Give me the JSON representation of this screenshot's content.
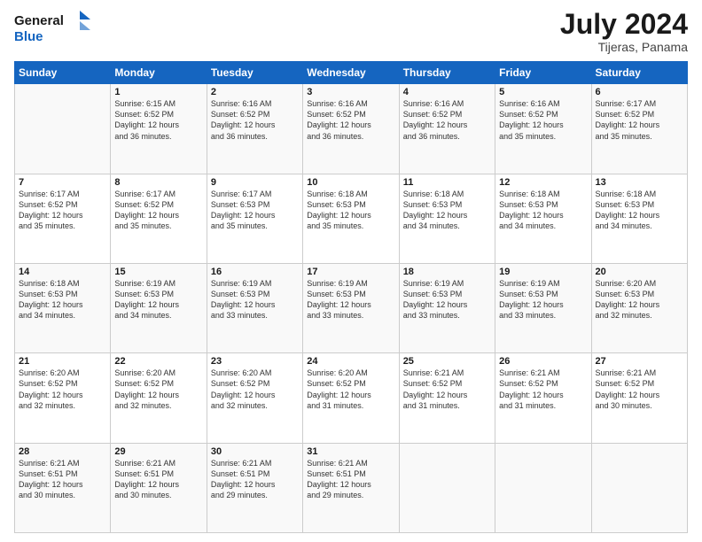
{
  "header": {
    "logo_line1": "General",
    "logo_line2": "Blue",
    "month_title": "July 2024",
    "location": "Tijeras, Panama"
  },
  "weekdays": [
    "Sunday",
    "Monday",
    "Tuesday",
    "Wednesday",
    "Thursday",
    "Friday",
    "Saturday"
  ],
  "weeks": [
    [
      {
        "day": null
      },
      {
        "day": "1",
        "sunrise": "6:15 AM",
        "sunset": "6:52 PM",
        "daylight": "12 hours and 36 minutes."
      },
      {
        "day": "2",
        "sunrise": "6:16 AM",
        "sunset": "6:52 PM",
        "daylight": "12 hours and 36 minutes."
      },
      {
        "day": "3",
        "sunrise": "6:16 AM",
        "sunset": "6:52 PM",
        "daylight": "12 hours and 36 minutes."
      },
      {
        "day": "4",
        "sunrise": "6:16 AM",
        "sunset": "6:52 PM",
        "daylight": "12 hours and 36 minutes."
      },
      {
        "day": "5",
        "sunrise": "6:16 AM",
        "sunset": "6:52 PM",
        "daylight": "12 hours and 35 minutes."
      },
      {
        "day": "6",
        "sunrise": "6:17 AM",
        "sunset": "6:52 PM",
        "daylight": "12 hours and 35 minutes."
      }
    ],
    [
      {
        "day": "7",
        "sunrise": "6:17 AM",
        "sunset": "6:52 PM",
        "daylight": "12 hours and 35 minutes."
      },
      {
        "day": "8",
        "sunrise": "6:17 AM",
        "sunset": "6:52 PM",
        "daylight": "12 hours and 35 minutes."
      },
      {
        "day": "9",
        "sunrise": "6:17 AM",
        "sunset": "6:53 PM",
        "daylight": "12 hours and 35 minutes."
      },
      {
        "day": "10",
        "sunrise": "6:18 AM",
        "sunset": "6:53 PM",
        "daylight": "12 hours and 35 minutes."
      },
      {
        "day": "11",
        "sunrise": "6:18 AM",
        "sunset": "6:53 PM",
        "daylight": "12 hours and 34 minutes."
      },
      {
        "day": "12",
        "sunrise": "6:18 AM",
        "sunset": "6:53 PM",
        "daylight": "12 hours and 34 minutes."
      },
      {
        "day": "13",
        "sunrise": "6:18 AM",
        "sunset": "6:53 PM",
        "daylight": "12 hours and 34 minutes."
      }
    ],
    [
      {
        "day": "14",
        "sunrise": "6:18 AM",
        "sunset": "6:53 PM",
        "daylight": "12 hours and 34 minutes."
      },
      {
        "day": "15",
        "sunrise": "6:19 AM",
        "sunset": "6:53 PM",
        "daylight": "12 hours and 34 minutes."
      },
      {
        "day": "16",
        "sunrise": "6:19 AM",
        "sunset": "6:53 PM",
        "daylight": "12 hours and 33 minutes."
      },
      {
        "day": "17",
        "sunrise": "6:19 AM",
        "sunset": "6:53 PM",
        "daylight": "12 hours and 33 minutes."
      },
      {
        "day": "18",
        "sunrise": "6:19 AM",
        "sunset": "6:53 PM",
        "daylight": "12 hours and 33 minutes."
      },
      {
        "day": "19",
        "sunrise": "6:19 AM",
        "sunset": "6:53 PM",
        "daylight": "12 hours and 33 minutes."
      },
      {
        "day": "20",
        "sunrise": "6:20 AM",
        "sunset": "6:53 PM",
        "daylight": "12 hours and 32 minutes."
      }
    ],
    [
      {
        "day": "21",
        "sunrise": "6:20 AM",
        "sunset": "6:52 PM",
        "daylight": "12 hours and 32 minutes."
      },
      {
        "day": "22",
        "sunrise": "6:20 AM",
        "sunset": "6:52 PM",
        "daylight": "12 hours and 32 minutes."
      },
      {
        "day": "23",
        "sunrise": "6:20 AM",
        "sunset": "6:52 PM",
        "daylight": "12 hours and 32 minutes."
      },
      {
        "day": "24",
        "sunrise": "6:20 AM",
        "sunset": "6:52 PM",
        "daylight": "12 hours and 31 minutes."
      },
      {
        "day": "25",
        "sunrise": "6:21 AM",
        "sunset": "6:52 PM",
        "daylight": "12 hours and 31 minutes."
      },
      {
        "day": "26",
        "sunrise": "6:21 AM",
        "sunset": "6:52 PM",
        "daylight": "12 hours and 31 minutes."
      },
      {
        "day": "27",
        "sunrise": "6:21 AM",
        "sunset": "6:52 PM",
        "daylight": "12 hours and 30 minutes."
      }
    ],
    [
      {
        "day": "28",
        "sunrise": "6:21 AM",
        "sunset": "6:51 PM",
        "daylight": "12 hours and 30 minutes."
      },
      {
        "day": "29",
        "sunrise": "6:21 AM",
        "sunset": "6:51 PM",
        "daylight": "12 hours and 30 minutes."
      },
      {
        "day": "30",
        "sunrise": "6:21 AM",
        "sunset": "6:51 PM",
        "daylight": "12 hours and 29 minutes."
      },
      {
        "day": "31",
        "sunrise": "6:21 AM",
        "sunset": "6:51 PM",
        "daylight": "12 hours and 29 minutes."
      },
      {
        "day": null
      },
      {
        "day": null
      },
      {
        "day": null
      }
    ]
  ],
  "labels": {
    "sunrise_prefix": "Sunrise: ",
    "sunset_prefix": "Sunset: ",
    "daylight_prefix": "Daylight: "
  }
}
